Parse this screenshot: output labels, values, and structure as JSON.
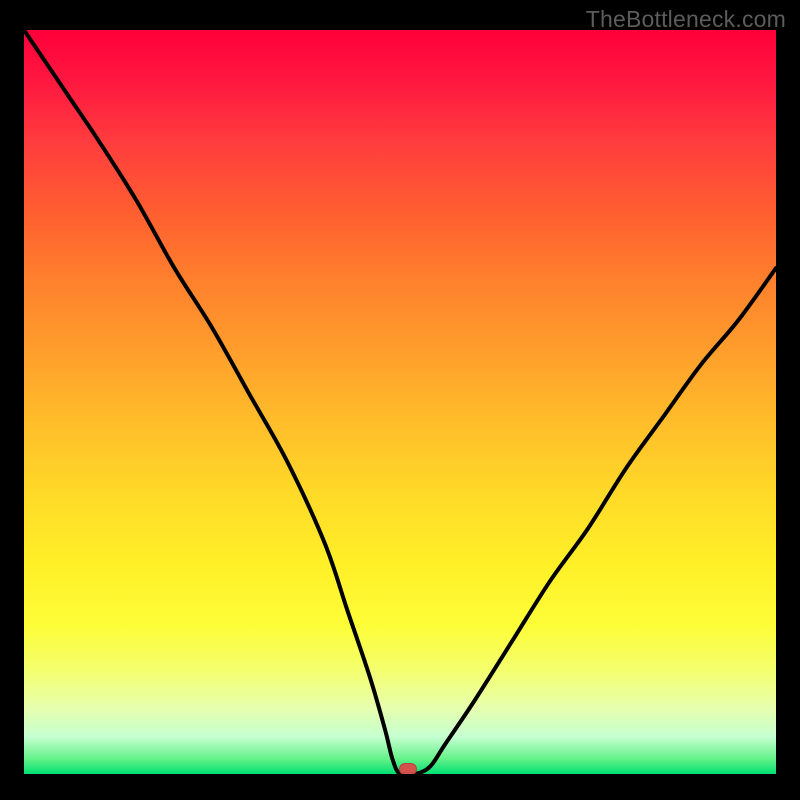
{
  "watermark": "TheBottleneck.com",
  "colors": {
    "curve_stroke": "#000000",
    "marker_fill": "#d4524b",
    "frame_bg": "#000000"
  },
  "chart_data": {
    "type": "line",
    "title": "",
    "xlabel": "",
    "ylabel": "",
    "xlim": [
      0,
      100
    ],
    "ylim": [
      0,
      100
    ],
    "grid": false,
    "legend": false,
    "note": "Axes unlabeled; values are normalized 0–100 estimated from pixel positions. y is a V-shaped bottleneck-style curve; minimum marked by a small red lozenge at the bottom.",
    "series": [
      {
        "name": "curve",
        "x": [
          0,
          2,
          6,
          10,
          15,
          20,
          25,
          30,
          35,
          40,
          43,
          46,
          48,
          49,
          50,
          52,
          54,
          56,
          60,
          65,
          70,
          75,
          80,
          85,
          90,
          95,
          100
        ],
        "y": [
          100,
          97,
          91,
          85,
          77,
          68,
          60,
          51,
          42,
          31,
          22,
          13,
          6,
          2,
          0,
          0,
          1,
          4,
          10,
          18,
          26,
          33,
          41,
          48,
          55,
          61,
          68
        ]
      }
    ],
    "marker": {
      "x": 51,
      "y": 0
    }
  }
}
